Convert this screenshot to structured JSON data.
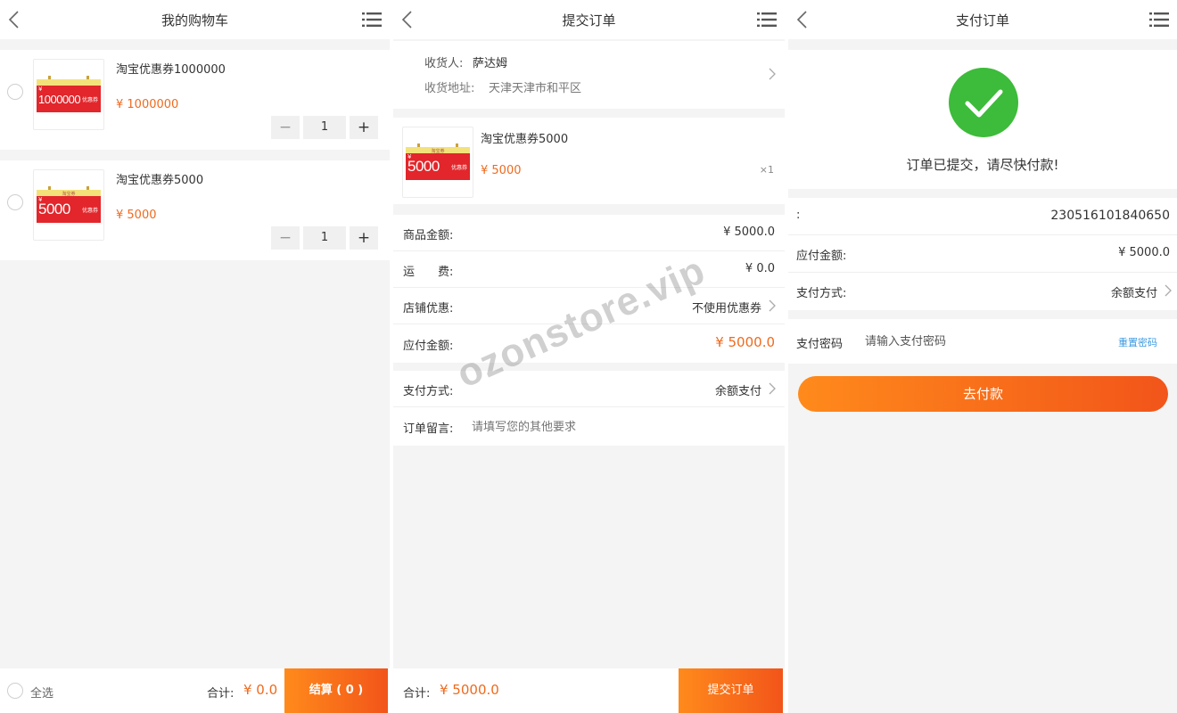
{
  "cart": {
    "title": "我的购物车",
    "items": [
      {
        "name": "淘宝优惠券1000000",
        "price": "¥ 1000000",
        "qty": "1",
        "coupon_amount": "1000000",
        "coupon_currency": "¥",
        "coupon_tag": "优惠券"
      },
      {
        "name": "淘宝优惠券5000",
        "price": "¥ 5000",
        "qty": "1",
        "coupon_amount": "5000",
        "coupon_currency": "¥",
        "coupon_tag": "优惠券",
        "coupon_top_text": "淘宝券"
      }
    ],
    "stepper": {
      "minus": "−",
      "plus": "+"
    },
    "select_all": "全选",
    "total_label": "合计:",
    "total_value": "¥ 0.0",
    "checkout_button": "结算 ( 0 )"
  },
  "order": {
    "title": "提交订单",
    "recipient_label": "收货人:",
    "recipient_name": "萨达姆",
    "address_label": "收货地址:",
    "address_value": "天津天津市和平区",
    "item": {
      "name": "淘宝优惠券5000",
      "price": "¥ 5000",
      "qty": "×1",
      "coupon_amount": "5000",
      "coupon_currency": "¥",
      "coupon_tag": "优惠券",
      "coupon_top_text": "淘宝券"
    },
    "rows": [
      {
        "label": "商品金额:",
        "value": "¥ 5000.0"
      },
      {
        "label": "运　　费:",
        "value": "¥ 0.0"
      },
      {
        "label": "店铺优惠:",
        "value": "不使用优惠券"
      },
      {
        "label": "应付金额:",
        "value": "¥ 5000.0"
      }
    ],
    "payment_label": "支付方式:",
    "payment_value": "余额支付",
    "note_label": "订单留言:",
    "note_placeholder": "请填写您的其他要求",
    "total_label": "合计:",
    "total_value": "¥ 5000.0",
    "submit_button": "提交订单"
  },
  "pay": {
    "title": "支付订单",
    "message": "订单已提交，请尽快付款!",
    "order_no_label": ":",
    "order_no_value": "230516101840650",
    "amount_label": "应付金额:",
    "amount_value": "¥ 5000.0",
    "method_label": "支付方式:",
    "method_value": "余额支付",
    "password_label": "支付密码",
    "password_placeholder": "请输入支付密码",
    "reset_password": "重置密码",
    "pay_button": "去付款"
  },
  "watermark": "ozonstore.vip",
  "colors": {
    "accent": "#ef6a1e",
    "success": "#3dbb3a",
    "link": "#3d9be0",
    "background": "#f4f4f4"
  },
  "icons": [
    "back-arrow-icon",
    "menu-list-icon",
    "chevron-right-icon",
    "checkmark-icon",
    "radio-icon"
  ]
}
